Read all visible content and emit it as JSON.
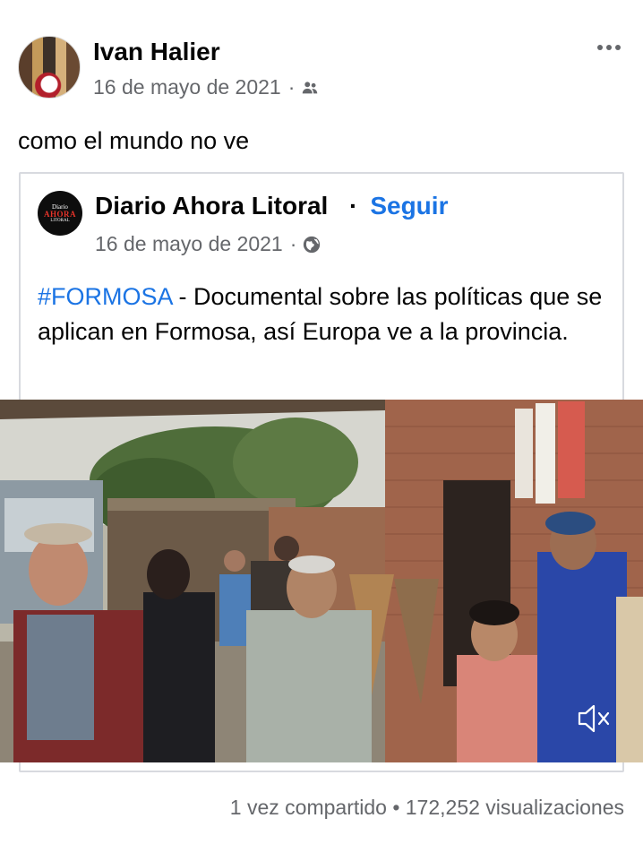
{
  "post": {
    "author": "Ivan Halier",
    "date": "16 de mayo de 2021",
    "separator": "·",
    "audience_icon": "friends-icon",
    "more_icon": "more-horizontal-icon",
    "text": "como el mundo no ve"
  },
  "shared_post": {
    "page_avatar": {
      "line1": "Diario",
      "line2": "AHORA",
      "line3": "LITORAL"
    },
    "page_name": "Diario Ahora Litoral",
    "follow_separator": "·",
    "follow_label": "Seguir",
    "date": "16 de mayo de 2021",
    "separator": "·",
    "audience_icon": "globe-icon",
    "hashtag": "#FORMOSA",
    "text": " - Documental sobre las políticas que se aplican en Formosa, así Europa ve a la provincia."
  },
  "video": {
    "mute_icon": "muted-speaker-icon"
  },
  "footer": {
    "stats": "1 vez compartido • 172,252 visualizaciones"
  },
  "colors": {
    "link_blue": "#1b74e4",
    "secondary_text": "#65676b",
    "primary_text": "#050505",
    "card_border": "#d8dadf"
  }
}
